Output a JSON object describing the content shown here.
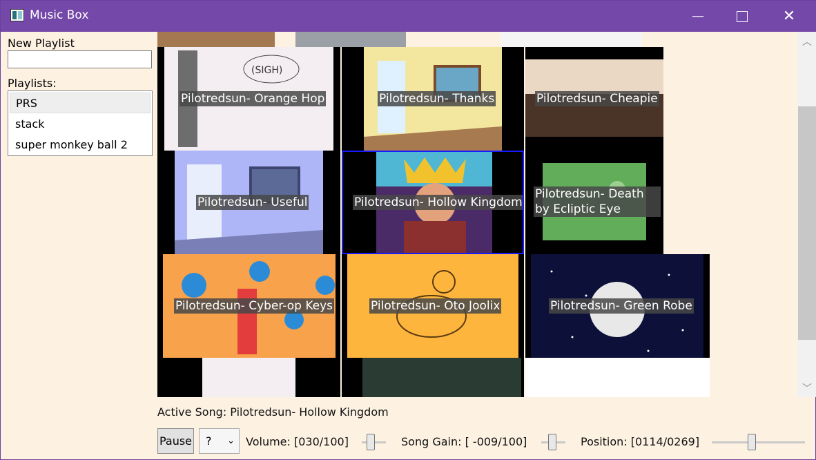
{
  "window": {
    "title": "Music Box"
  },
  "sidebar": {
    "new_playlist_label": "New Playlist",
    "playlists_label": "Playlists:",
    "playlists": [
      "PRS",
      "stack",
      "super monkey ball 2"
    ],
    "selected": "PRS"
  },
  "grid": {
    "tiles": [
      {
        "title": "Pilotredsun- Orange Hop",
        "selected": false
      },
      {
        "title": "Pilotredsun- Thanks",
        "selected": false
      },
      {
        "title": "Pilotredsun- Cheapie",
        "selected": false
      },
      {
        "title": "Pilotredsun- Useful",
        "selected": false
      },
      {
        "title": "Pilotredsun- Hollow Kingdom",
        "selected": true
      },
      {
        "title": "Pilotredsun- Death by Ecliptic Eye",
        "selected": false
      },
      {
        "title": "Pilotredsun- Cyber-op Keys",
        "selected": false
      },
      {
        "title": "Pilotredsun- Oto Joolix",
        "selected": false
      },
      {
        "title": "Pilotredsun- Green Robe",
        "selected": false
      }
    ]
  },
  "player": {
    "active_song_text": "Active Song: Pilotredsun- Hollow Kingdom",
    "pause_label": "Pause",
    "combo_value": "?",
    "volume_text": "Volume: [030/100]",
    "gain_text": "Song Gain: [ -009/100]",
    "position_text": "Position: [0114/0269]",
    "volume": 30,
    "gain": -9,
    "position": 114,
    "duration": 269
  }
}
